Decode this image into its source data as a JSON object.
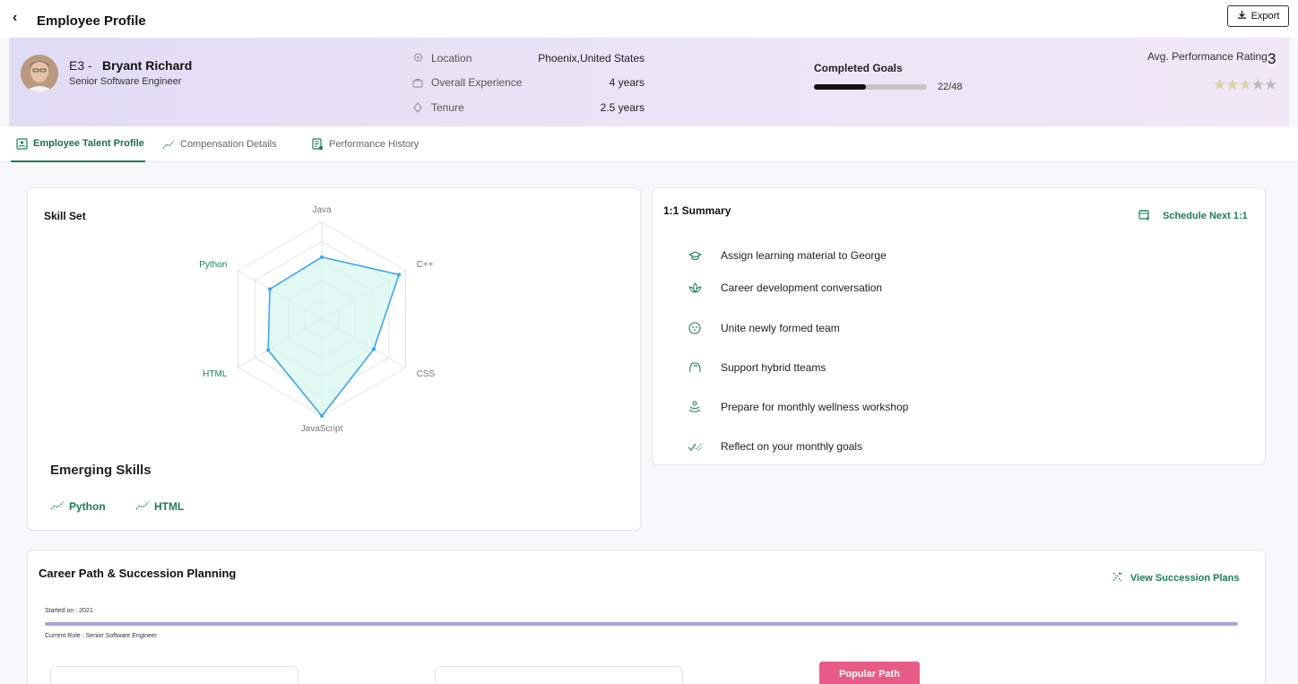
{
  "app": {
    "back_icon": "chevron-left-icon",
    "title": "Employee Profile",
    "export_label": "Export",
    "export_icon": "download-icon"
  },
  "employee": {
    "code": "E3 -",
    "name": "Bryant Richard",
    "role": "Senior Software Engineer",
    "details": [
      {
        "label": "Location",
        "value": "Phoenix,United States",
        "icon": "location-pin-icon"
      },
      {
        "label": "Overall Experience",
        "value": "4 years",
        "icon": "briefcase-icon"
      },
      {
        "label": "Tenure",
        "value": "2.5 years",
        "icon": "diamond-icon"
      }
    ],
    "goals": {
      "label": "Completed Goals",
      "completed": 22,
      "total": 48,
      "text": "22/48"
    },
    "rating": {
      "label": "Avg. Performance Rating",
      "value": "3",
      "stars_filled": 3,
      "stars_total": 5
    }
  },
  "tabs": [
    {
      "label": "Employee Talent Profile",
      "icon": "profile-card-icon",
      "active": true
    },
    {
      "label": "Compensation Details",
      "icon": "trend-icon",
      "active": false
    },
    {
      "label": "Performance History",
      "icon": "document-icon",
      "active": false
    }
  ],
  "skills": {
    "title": "Skill Set",
    "emerging_title": "Emerging Skills",
    "emerging": [
      "Python",
      "HTML"
    ]
  },
  "chart_data": {
    "type": "radar",
    "title": "",
    "axes": [
      "Java",
      "C++",
      "CSS",
      "JavaScript",
      "HTML",
      "Python"
    ],
    "highlighted_axes": [
      "Python",
      "HTML"
    ],
    "levels": 5,
    "max": 5,
    "values": [
      3.2,
      4.6,
      3.1,
      5.0,
      3.2,
      3.1
    ],
    "color": "#3aa7f0",
    "fill": "#d9f7ef"
  },
  "summary": {
    "title": "1:1 Summary",
    "schedule_label": "Schedule Next 1:1",
    "items": [
      {
        "text": "Assign learning material to George",
        "icon": "graduation-cap-icon"
      },
      {
        "text": "Career development conversation",
        "icon": "lotus-icon"
      },
      {
        "text": "Unite newly formed team",
        "icon": "team-circle-icon"
      },
      {
        "text": "Support hybrid tteams",
        "icon": "support-hand-icon"
      },
      {
        "text": "Prepare for monthly wellness workshop",
        "icon": "wellness-icon"
      },
      {
        "text": "Reflect on your monthly goals",
        "icon": "check-trend-icon"
      }
    ]
  },
  "career": {
    "title": "Career Path & Succession Planning",
    "view_plans_label": "View Succession Plans",
    "started_on": "Started on : 2021",
    "current_role": "Current Role : Senior Software Engineer",
    "popular_label": "Popular Path"
  },
  "colors": {
    "accent": "#1c7d5a",
    "timeline": "#a8a3e3",
    "popular": "#e85b87"
  }
}
